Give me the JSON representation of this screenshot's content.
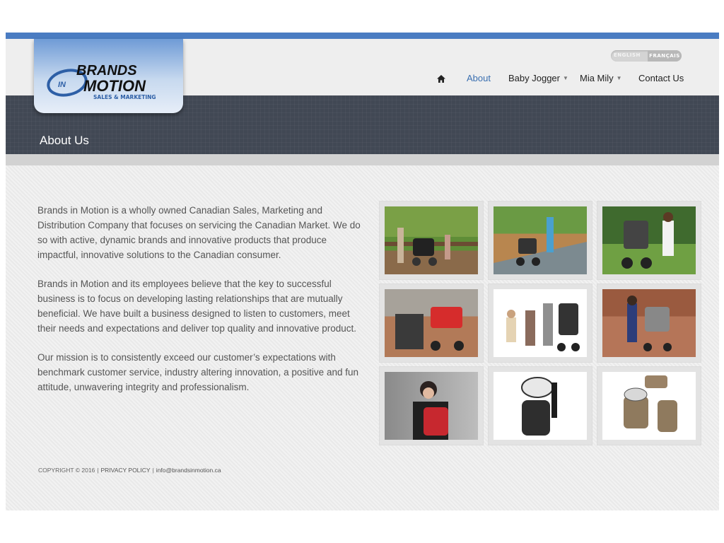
{
  "logo": {
    "line1": "BRANDS",
    "badge": "IN",
    "line2": "MOTION",
    "tagline": "SALES & MARKETING"
  },
  "language": {
    "english": "ENGLISH",
    "french": "FRANÇAIS"
  },
  "nav": {
    "home_icon": "home-icon",
    "items": [
      {
        "label": "About",
        "active": true
      },
      {
        "label": "Baby Jogger",
        "dropdown": true
      },
      {
        "label": "Mia Mily",
        "dropdown": true
      },
      {
        "label": "Contact Us"
      }
    ]
  },
  "banner": {
    "title": "About Us"
  },
  "content": {
    "paragraphs": [
      "Brands in Motion is a wholly owned Canadian Sales, Marketing and Distribution Company that focuses on servicing the Canadian Market. We do so with active, dynamic brands and innovative products that produce impactful, innovative solutions to the Canadian consumer.",
      "Brands in Motion and its employees believe that the key to successful business is to focus on developing lasting relationships that are mutually beneficial. We have built a business designed to listen to customers, meet their needs and expectations and deliver top quality and innovative product.",
      "Our mission is to consistently exceed our customer’s expectations with benchmark customer service, industry altering innovation, a positive and fun attitude, unwavering integrity and professionalism."
    ]
  },
  "gallery": [
    "stroller-dock-photo",
    "stroller-boardwalk-photo",
    "stroller-garden-photo",
    "double-stroller-photo",
    "family-stroller-photo",
    "patio-stroller-photo",
    "baby-carrier-photo",
    "black-hip-seat-photo",
    "tan-hip-seat-photo"
  ],
  "footer": {
    "copyright": "COPYRIGHT © 2016",
    "privacy": "PRIVACY POLICY",
    "email": "info@brandsinmotion.ca"
  },
  "colors": {
    "accent": "#4a7cc2",
    "banner": "#414854",
    "nav_active": "#3a6fb0",
    "text": "#555555"
  }
}
